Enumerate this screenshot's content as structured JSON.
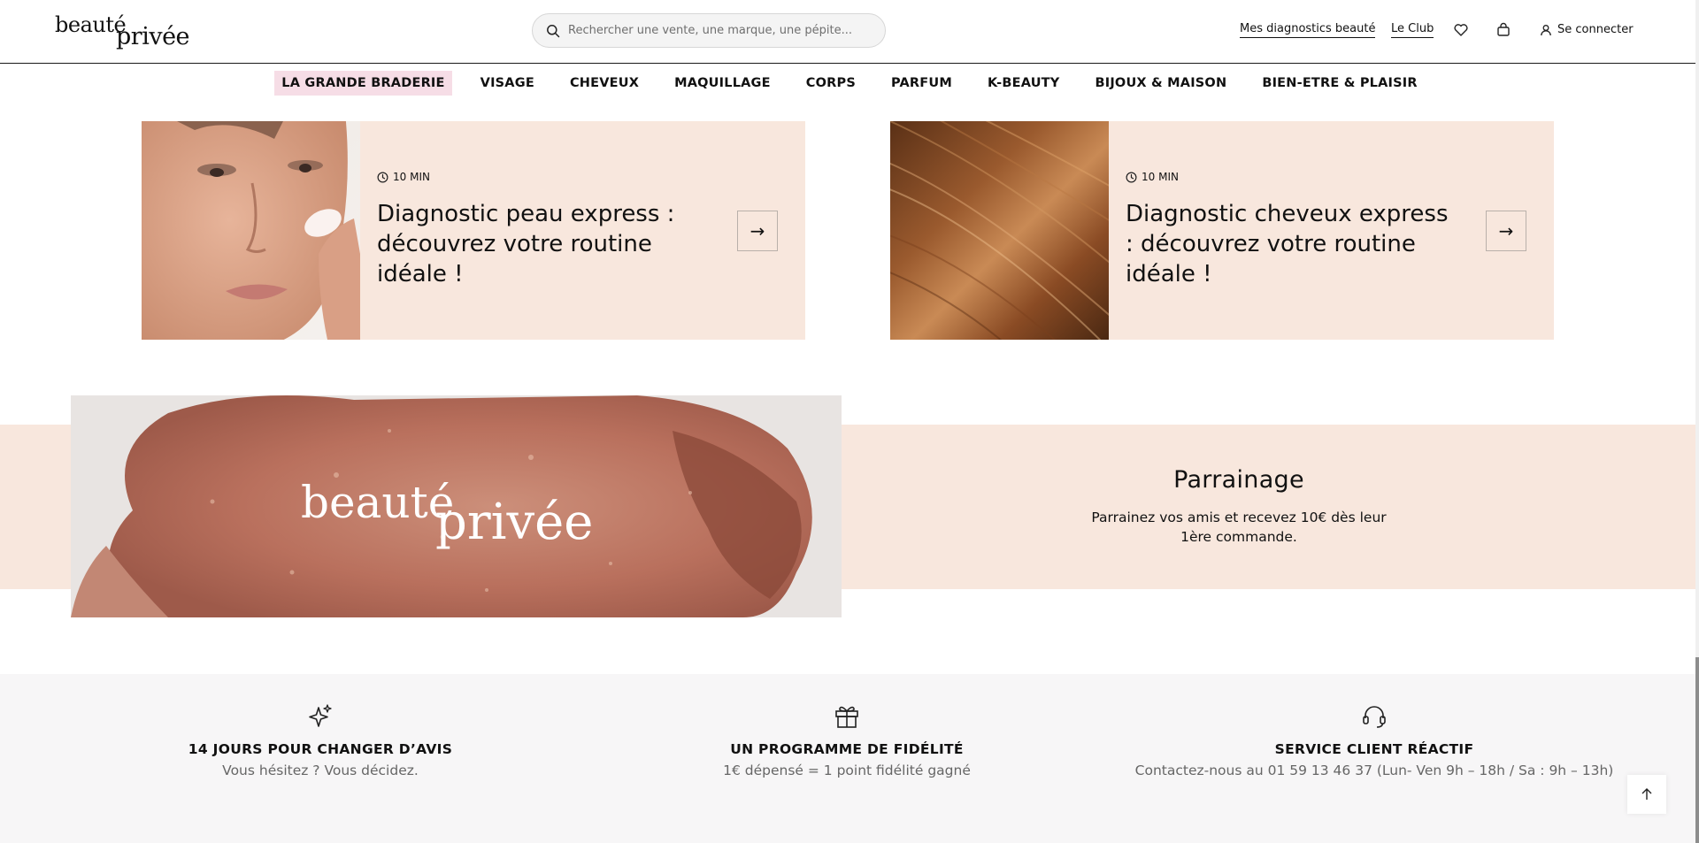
{
  "header": {
    "logo_part1": "beauté",
    "logo_part2": "privée",
    "search_placeholder": "Rechercher une vente, une marque, une pépite...",
    "links": [
      "Mes diagnostics beauté",
      "Le Club"
    ],
    "login_label": "Se connecter"
  },
  "nav": {
    "items": [
      "LA GRANDE BRADERIE",
      "VISAGE",
      "CHEVEUX",
      "MAQUILLAGE",
      "CORPS",
      "PARFUM",
      "K-BEAUTY",
      "BIJOUX & MAISON",
      "BIEN-ETRE & PLAISIR"
    ]
  },
  "cards": [
    {
      "duration": "10 MIN",
      "title": "Diagnostic peau express : découvrez votre routine idéale !"
    },
    {
      "duration": "10 MIN",
      "title": "Diagnostic cheveux express : découvrez votre routine idéale !"
    }
  ],
  "parrainage": {
    "logo_part1": "beauté",
    "logo_part2": "privée",
    "title": "Parrainage",
    "text": "Parrainez vos amis et recevez 10€ dès leur 1ère commande."
  },
  "benefits": [
    {
      "icon": "sparkles-icon",
      "title": "14 JOURS POUR CHANGER D’AVIS",
      "desc": "Vous hésitez ? Vous décidez."
    },
    {
      "icon": "gift-icon",
      "title": "UN PROGRAMME DE FIDÉLITÉ",
      "desc": "1€ dépensé = 1 point fidélité gagné"
    },
    {
      "icon": "headset-icon",
      "title": "SERVICE CLIENT RÉACTIF",
      "desc": "Contactez-nous au 01 59 13 46 37 (Lun- Ven 9h – 18h / Sa : 9h – 13h)"
    }
  ],
  "colors": {
    "accent_pink": "#f6dde6",
    "card_bg": "#f8e7dd",
    "footer_bg": "#f7f6f7"
  }
}
